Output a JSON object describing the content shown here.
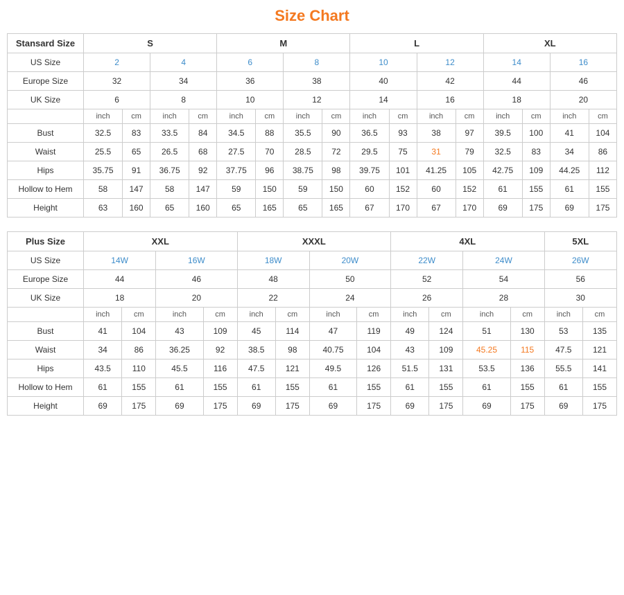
{
  "title": "Size Chart",
  "standard": {
    "table_title": "Stansard Size",
    "size_groups": [
      "S",
      "M",
      "L",
      "XL"
    ],
    "us_sizes": [
      "2",
      "4",
      "6",
      "8",
      "10",
      "12",
      "14",
      "16"
    ],
    "europe_sizes": [
      "32",
      "34",
      "36",
      "38",
      "40",
      "42",
      "44",
      "46"
    ],
    "uk_sizes": [
      "6",
      "8",
      "10",
      "12",
      "14",
      "16",
      "18",
      "20"
    ],
    "sub_headers": [
      "inch",
      "cm",
      "inch",
      "cm",
      "inch",
      "cm",
      "inch",
      "cm",
      "inch",
      "cm",
      "inch",
      "cm",
      "inch",
      "cm",
      "inch",
      "cm"
    ],
    "rows": [
      {
        "label": "Bust",
        "values": [
          "32.5",
          "83",
          "33.5",
          "84",
          "34.5",
          "88",
          "35.5",
          "90",
          "36.5",
          "93",
          "38",
          "97",
          "39.5",
          "100",
          "41",
          "104"
        ]
      },
      {
        "label": "Waist",
        "values": [
          "25.5",
          "65",
          "26.5",
          "68",
          "27.5",
          "70",
          "28.5",
          "72",
          "29.5",
          "75",
          "31",
          "79",
          "32.5",
          "83",
          "34",
          "86"
        ]
      },
      {
        "label": "Hips",
        "values": [
          "35.75",
          "91",
          "36.75",
          "92",
          "37.75",
          "96",
          "38.75",
          "98",
          "39.75",
          "101",
          "41.25",
          "105",
          "42.75",
          "109",
          "44.25",
          "112"
        ]
      },
      {
        "label": "Hollow to Hem",
        "values": [
          "58",
          "147",
          "58",
          "147",
          "59",
          "150",
          "59",
          "150",
          "60",
          "152",
          "60",
          "152",
          "61",
          "155",
          "61",
          "155"
        ]
      },
      {
        "label": "Height",
        "values": [
          "63",
          "160",
          "65",
          "160",
          "65",
          "165",
          "65",
          "165",
          "67",
          "170",
          "67",
          "170",
          "69",
          "175",
          "69",
          "175"
        ]
      }
    ]
  },
  "plus": {
    "table_title": "Plus Size",
    "size_groups": [
      "XXL",
      "XXXL",
      "4XL",
      "5XL"
    ],
    "us_sizes": [
      "14W",
      "16W",
      "18W",
      "20W",
      "22W",
      "24W",
      "26W"
    ],
    "europe_sizes": [
      "44",
      "46",
      "48",
      "50",
      "52",
      "54",
      "56"
    ],
    "uk_sizes": [
      "18",
      "20",
      "22",
      "24",
      "26",
      "28",
      "30"
    ],
    "sub_headers": [
      "inch",
      "cm",
      "inch",
      "cm",
      "inch",
      "cm",
      "inch",
      "cm",
      "inch",
      "cm",
      "inch",
      "cm",
      "inch",
      "cm"
    ],
    "rows": [
      {
        "label": "Bust",
        "values": [
          "41",
          "104",
          "43",
          "109",
          "45",
          "114",
          "47",
          "119",
          "49",
          "124",
          "51",
          "130",
          "53",
          "135"
        ]
      },
      {
        "label": "Waist",
        "values": [
          "34",
          "86",
          "36.25",
          "92",
          "38.5",
          "98",
          "40.75",
          "104",
          "43",
          "109",
          "45.25",
          "115",
          "47.5",
          "121"
        ]
      },
      {
        "label": "Hips",
        "values": [
          "43.5",
          "110",
          "45.5",
          "116",
          "47.5",
          "121",
          "49.5",
          "126",
          "51.5",
          "131",
          "53.5",
          "136",
          "55.5",
          "141"
        ]
      },
      {
        "label": "Hollow to Hem",
        "values": [
          "61",
          "155",
          "61",
          "155",
          "61",
          "155",
          "61",
          "155",
          "61",
          "155",
          "61",
          "155",
          "61",
          "155"
        ]
      },
      {
        "label": "Height",
        "values": [
          "69",
          "175",
          "69",
          "175",
          "69",
          "175",
          "69",
          "175",
          "69",
          "175",
          "69",
          "175",
          "69",
          "175"
        ]
      }
    ]
  }
}
